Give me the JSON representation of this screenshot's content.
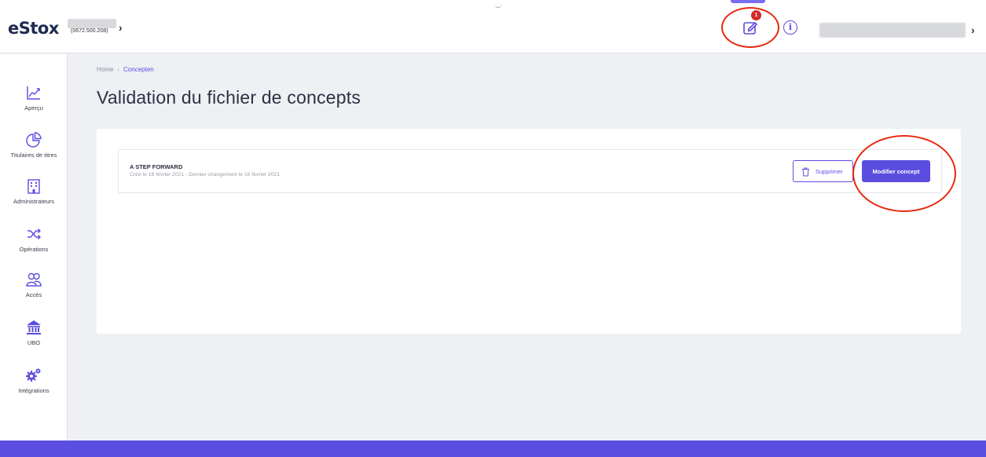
{
  "header": {
    "logo": "eStox",
    "company_id": "(0672.500.208)",
    "chevron": "›",
    "notification_count": "1",
    "info_glyph": "i"
  },
  "sidebar": {
    "items": [
      {
        "label": "Aperçu",
        "icon": "chart-line-icon"
      },
      {
        "label": "Titulaires de titres",
        "icon": "pie-chart-icon"
      },
      {
        "label": "Administrateurs",
        "icon": "building-icon"
      },
      {
        "label": "Opérations",
        "icon": "shuffle-icon"
      },
      {
        "label": "Accès",
        "icon": "users-icon"
      },
      {
        "label": "UBO",
        "icon": "bank-icon"
      },
      {
        "label": "Intégrations",
        "icon": "gears-icon"
      }
    ]
  },
  "breadcrumb": {
    "home": "Home",
    "separator": "›",
    "current": "Concepten"
  },
  "page_title": "Validation du fichier de concepts",
  "concept": {
    "name": "A STEP FORWARD",
    "meta": "Créé le 16 février 2021 - Dernier changement le 16 février 2021"
  },
  "actions": {
    "delete_label": "Supprimer",
    "edit_label": "Modifier concept"
  },
  "colors": {
    "accent": "#5b4de0",
    "badge": "#d62828",
    "annotation": "#e8290f"
  }
}
